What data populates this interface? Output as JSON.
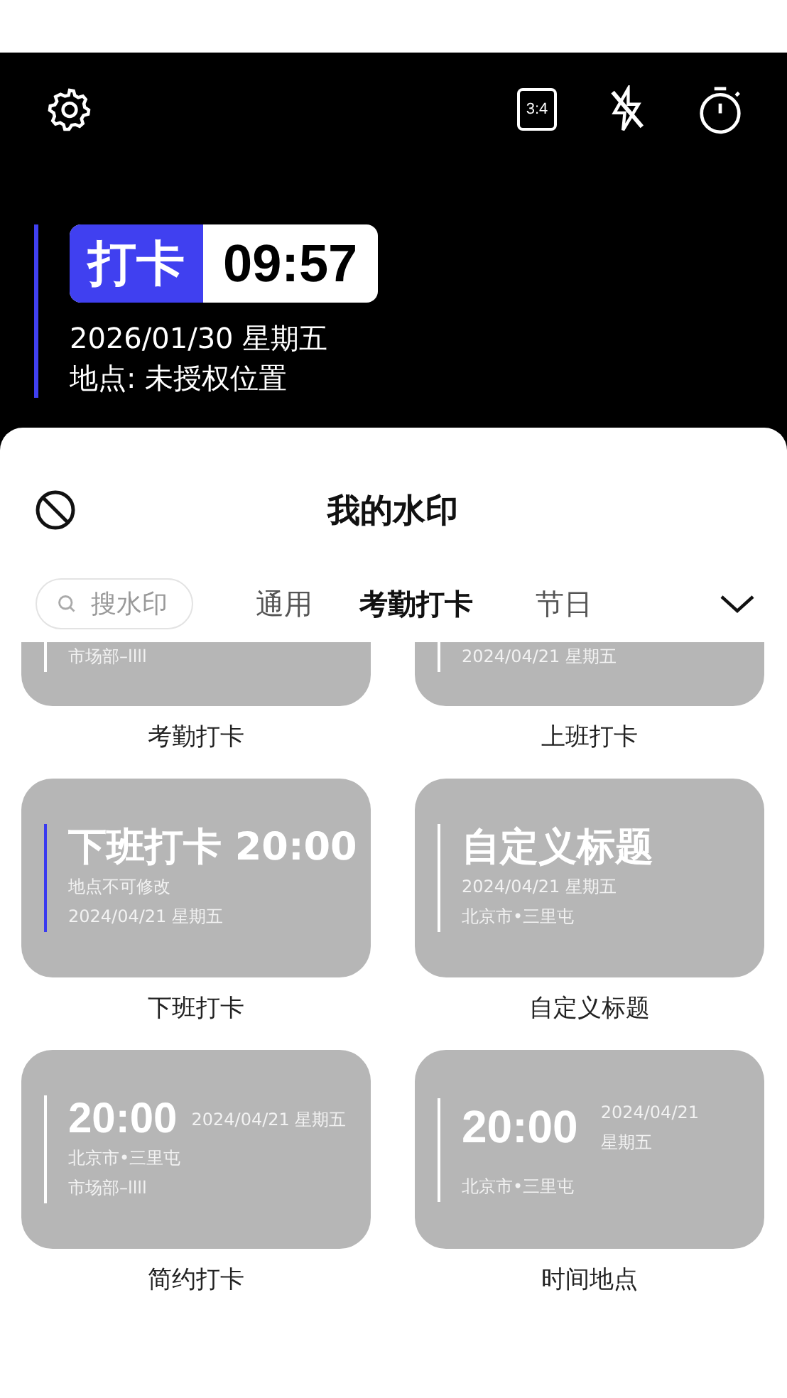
{
  "camera": {
    "aspect_label": "3:4",
    "watermark": {
      "tag": "打卡",
      "time": "09:57",
      "date": "2026/01/30 星期五",
      "location": "地点: 未授权位置"
    }
  },
  "sheet": {
    "title": "我的水印",
    "search": {
      "placeholder": "搜水印"
    },
    "tabs": [
      {
        "label": "通用",
        "selected": false
      },
      {
        "label": "考勤打卡",
        "selected": true
      },
      {
        "label": "节日",
        "selected": false
      }
    ],
    "watermarks": [
      {
        "kind": "clipped",
        "label": "考勤打卡",
        "lines": [
          "市场部–llll"
        ]
      },
      {
        "kind": "clipped",
        "label": "上班打卡",
        "lines": [
          "2024/04/21  星期五"
        ]
      },
      {
        "kind": "headline",
        "label": "下班打卡",
        "title": "下班打卡 20:00",
        "lines": [
          "地点不可修改",
          "2024/04/21  星期五"
        ],
        "color": "#3a3af0"
      },
      {
        "kind": "headline",
        "label": "自定义标题",
        "title": "自定义标题",
        "lines": [
          "2024/04/21  星期五",
          "北京市•三里屯"
        ],
        "color": "#ffffff"
      },
      {
        "kind": "inline",
        "label": "简约打卡",
        "time": "20:00",
        "date": "2024/04/21 星期五",
        "lines": [
          "北京市•三里屯",
          "市场部–llll"
        ]
      },
      {
        "kind": "stacked",
        "label": "时间地点",
        "time": "20:00",
        "date": "2024/04/21 星期五",
        "lines": [
          "北京市•三里屯"
        ]
      }
    ]
  }
}
